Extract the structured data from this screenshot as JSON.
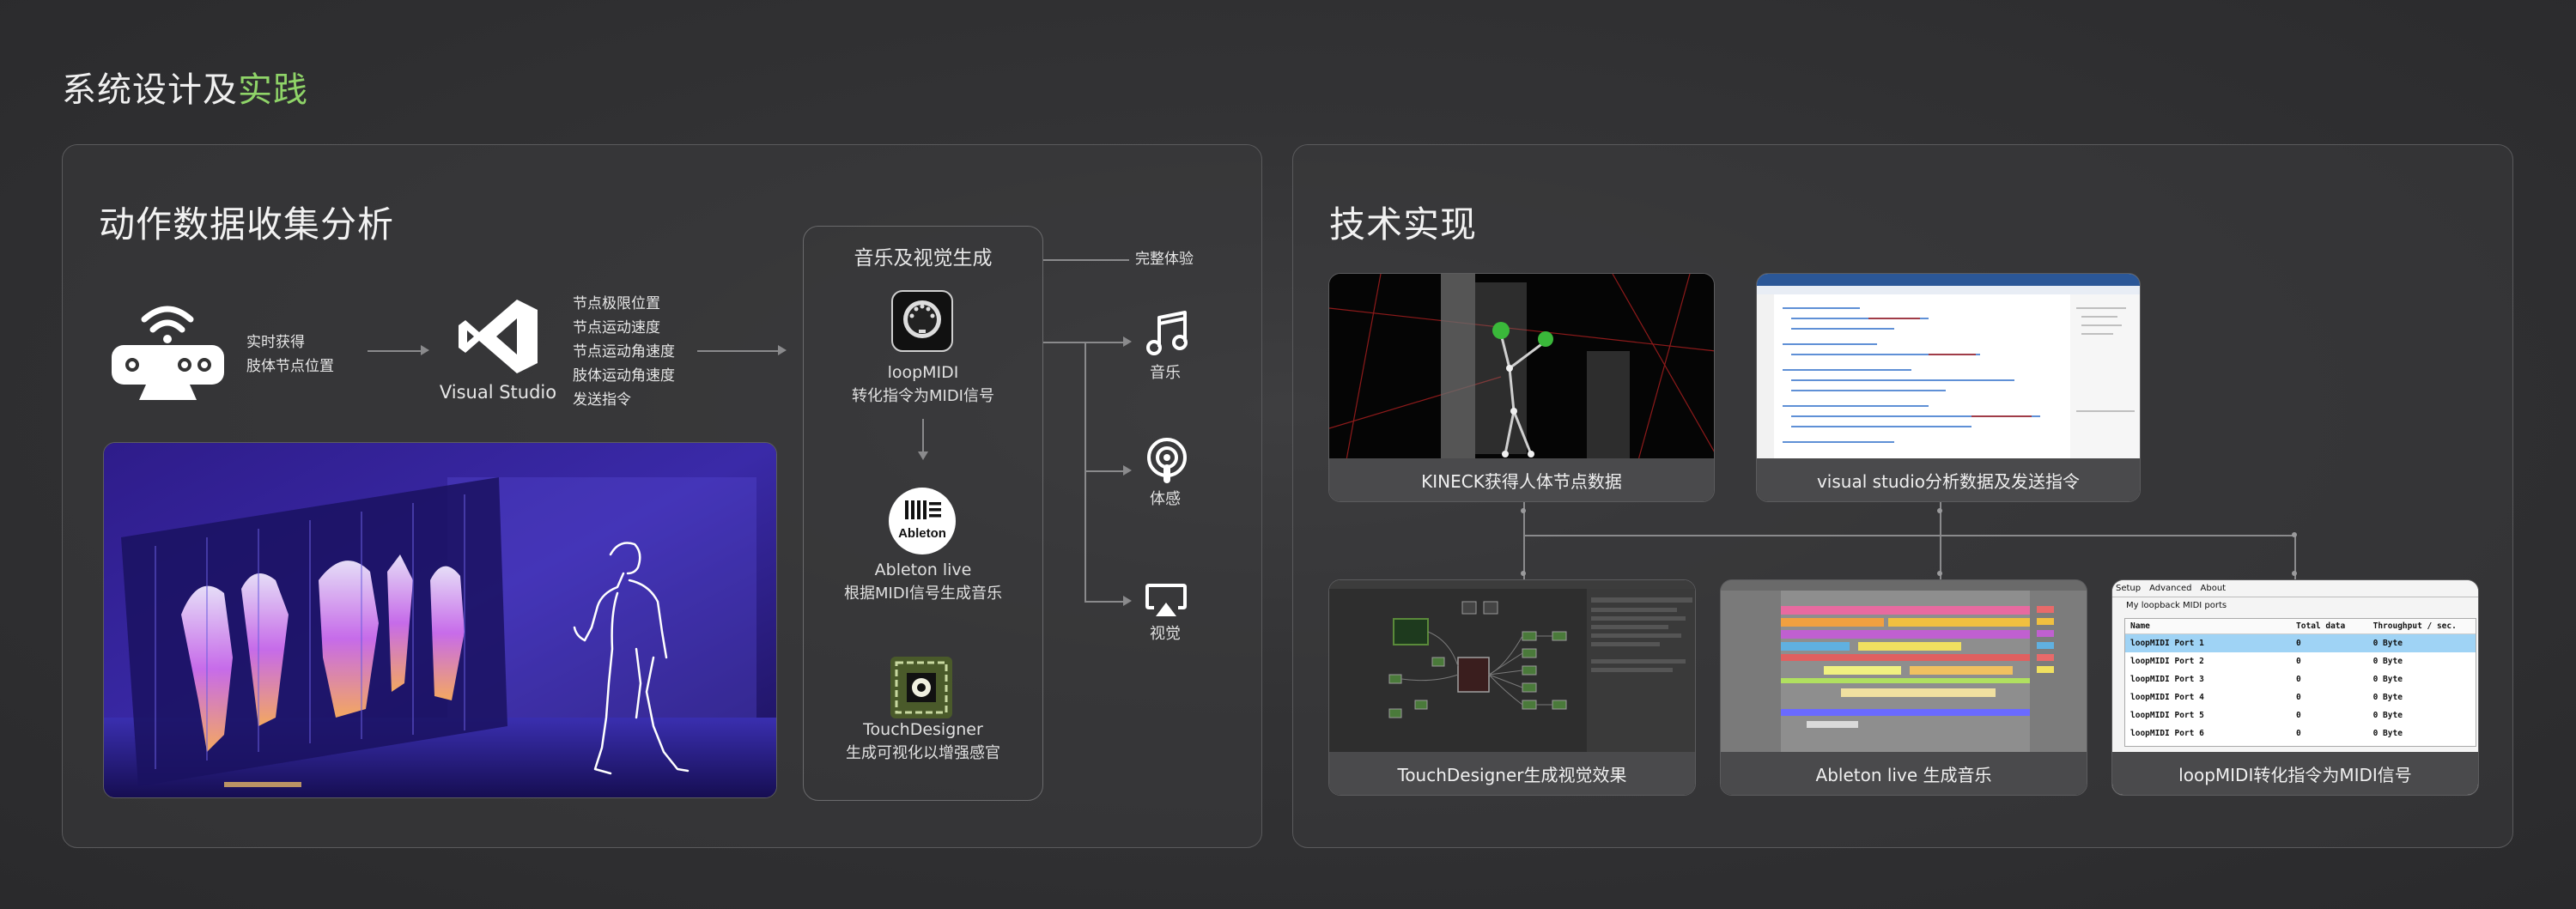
{
  "page": {
    "title_main": "系统设计及",
    "title_highlight": "实践"
  },
  "left_panel": {
    "title": "动作数据收集分析",
    "kinect_desc_line1": "实时获得",
    "kinect_desc_line2": "肢体节点位置",
    "vs_label": "Visual Studio",
    "vs_outputs": [
      "节点极限位置",
      "节点运动速度",
      "节点运动角速度",
      "肢体运动角速度",
      "发送指令"
    ],
    "music_box": {
      "title": "音乐及视觉生成",
      "loopmidi_name": "loopMIDI",
      "loopmidi_desc": "转化指令为MIDI信号",
      "ableton_badge": "Ableton",
      "ableton_name": "Ableton live",
      "ableton_desc": "根据MIDI信号生成音乐",
      "td_name": "TouchDesigner",
      "td_desc": "生成可视化以增强感官"
    },
    "experience": {
      "title": "完整体验",
      "items": [
        "音乐",
        "体感",
        "视觉"
      ]
    }
  },
  "right_panel": {
    "title": "技术实现",
    "cards": [
      "KINECK获得人体节点数据",
      "visual studio分析数据及发送指令",
      "TouchDesigner生成视觉效果",
      "Ableton  live  生成音乐",
      "loopMIDI转化指令为MIDI信号"
    ],
    "loopmidi_ui": {
      "tabs": [
        "Setup",
        "Advanced",
        "About"
      ],
      "section": "My loopback MIDI ports",
      "headers": [
        "Name",
        "Total data",
        "Throughput / sec."
      ],
      "rows": [
        [
          "loopMIDI Port 1",
          "0",
          "0 Byte"
        ],
        [
          "loopMIDI Port 2",
          "0",
          "0 Byte"
        ],
        [
          "loopMIDI Port 3",
          "0",
          "0 Byte"
        ],
        [
          "loopMIDI Port 4",
          "0",
          "0 Byte"
        ],
        [
          "loopMIDI Port 5",
          "0",
          "0 Byte"
        ],
        [
          "loopMIDI Port 6",
          "0",
          "0 Byte"
        ]
      ]
    }
  },
  "colors": {
    "accent_green": "#8fd468",
    "panel_border": "#5a5a5c",
    "caption_bg": "#4a4a4c"
  }
}
